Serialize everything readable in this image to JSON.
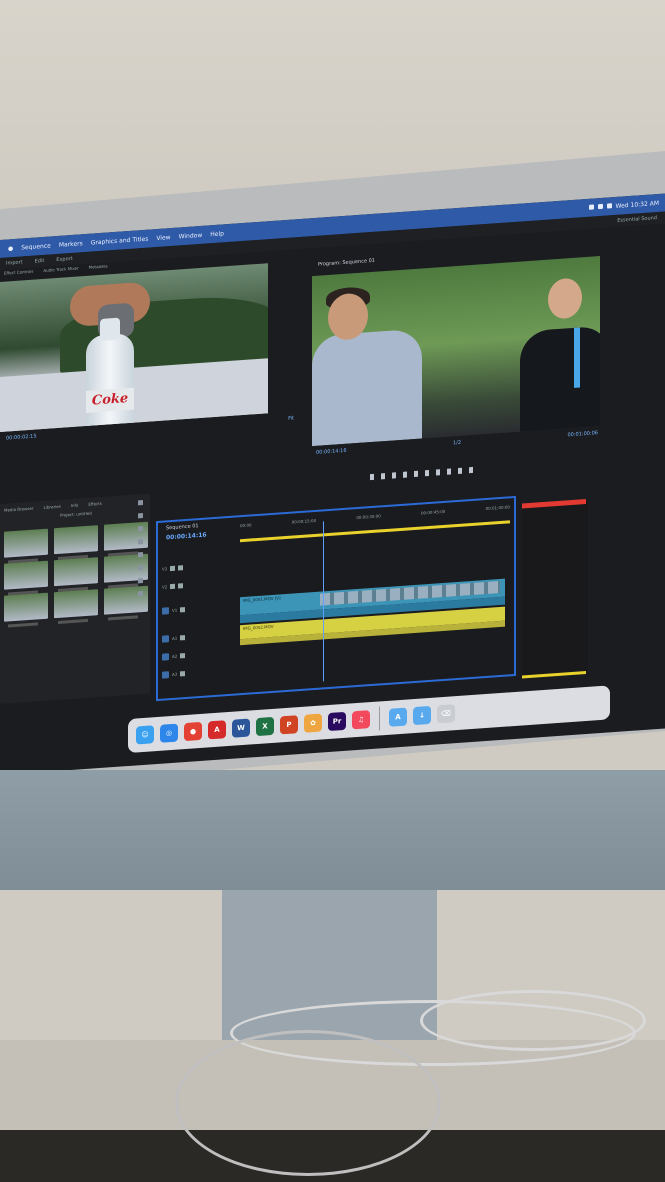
{
  "menubar": {
    "items": [
      "Sequence",
      "Markers",
      "Graphics and Titles",
      "View",
      "Window",
      "Help"
    ],
    "status": "Wed 10:32 AM"
  },
  "workspace": {
    "tabs": [
      "Import",
      "Edit",
      "Export"
    ],
    "right_label": "Essential Sound"
  },
  "source_monitor": {
    "tabs": [
      "Effect Controls",
      "Audio Track Mixer",
      "Metadata"
    ],
    "label_text": "Coke",
    "timecode_in": "00:00:02:15",
    "fit": "Fit"
  },
  "program_monitor": {
    "title": "Program: Sequence 01",
    "timecode": "00:00:14:16",
    "duration": "00:01:00:06",
    "fit": "1/2"
  },
  "project_panel": {
    "tabs": [
      "Media Browser",
      "Libraries",
      "Info",
      "Effects"
    ],
    "title": "Project: untitled"
  },
  "timeline": {
    "tab": "Sequence 01",
    "timecode": "00:00:14:16",
    "ruler": [
      "00:00",
      "00:00:15:00",
      "00:00:30:00",
      "00:00:45:00",
      "00:01:00:00"
    ],
    "tracks": [
      "V3",
      "V2",
      "V1",
      "A1",
      "A2",
      "A3"
    ],
    "clip_label": "IMG_0001.MOV [V]",
    "clip_label2": "IMG_0002.MOV"
  },
  "dock": {
    "apps": [
      {
        "name": "Finder",
        "icon": "finder-icon",
        "color": "#3aa0f0",
        "glyph": "☺"
      },
      {
        "name": "Safari",
        "icon": "safari-icon",
        "color": "#2f86ea",
        "glyph": "◎"
      },
      {
        "name": "Chrome",
        "icon": "chrome-icon",
        "color": "#e34133",
        "glyph": "●"
      },
      {
        "name": "Acrobat",
        "icon": "acrobat-icon",
        "color": "#d62a2a",
        "glyph": "A"
      },
      {
        "name": "Word",
        "icon": "word-icon",
        "color": "#2b579a",
        "glyph": "W"
      },
      {
        "name": "Excel",
        "icon": "excel-icon",
        "color": "#1f7244",
        "glyph": "X"
      },
      {
        "name": "PowerPoint",
        "icon": "powerpoint-icon",
        "color": "#d04423",
        "glyph": "P"
      },
      {
        "name": "Photos",
        "icon": "photos-icon",
        "color": "#f0a640",
        "glyph": "✿"
      },
      {
        "name": "Premiere Pro",
        "icon": "premiere-icon",
        "color": "#2a0a5e",
        "glyph": "Pr"
      },
      {
        "name": "Music",
        "icon": "music-icon",
        "color": "#f24a5c",
        "glyph": "♫"
      },
      {
        "name": "Applications",
        "icon": "applications-folder-icon",
        "color": "#58a9ee",
        "glyph": "A"
      },
      {
        "name": "Downloads",
        "icon": "downloads-folder-icon",
        "color": "#58a9ee",
        "glyph": "↓"
      },
      {
        "name": "Trash",
        "icon": "trash-icon",
        "color": "#c9ccd1",
        "glyph": "⌫"
      }
    ]
  }
}
